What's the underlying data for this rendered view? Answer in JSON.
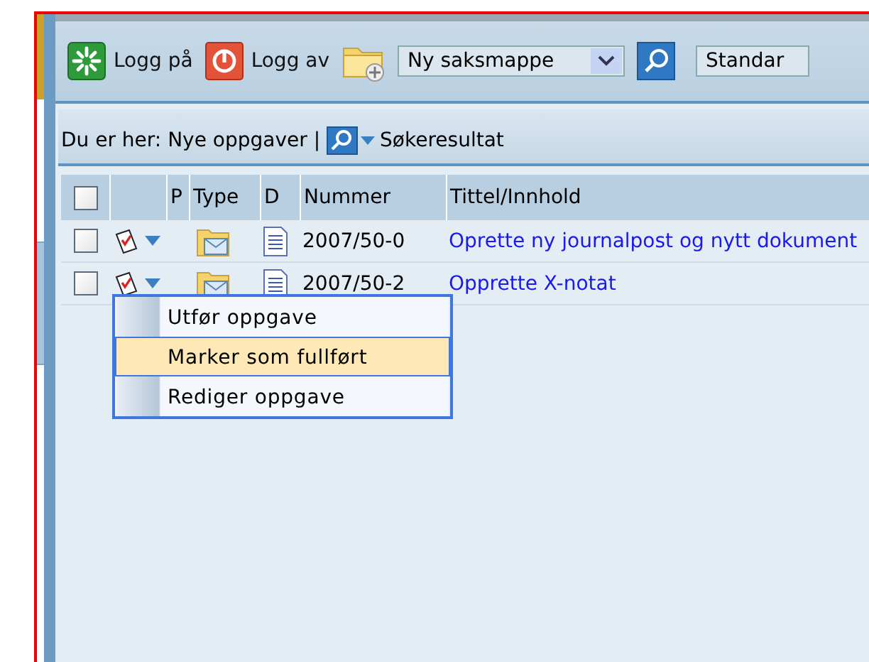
{
  "toolbar": {
    "items": [
      {
        "kind": "login",
        "label": "Logg på"
      },
      {
        "kind": "logout",
        "label": "Logg av"
      },
      {
        "kind": "new-folder"
      },
      {
        "kind": "select",
        "value": "Ny saksmappe"
      },
      {
        "kind": "search"
      },
      {
        "kind": "select",
        "value": "Standar"
      }
    ]
  },
  "breadcrumb": {
    "label": "Du er her: Nye oppgaver |",
    "current": "Søkeresultat"
  },
  "table": {
    "select_all": {
      "checked": false
    },
    "columns": [
      "P",
      "Type",
      "D",
      "Nummer",
      "Tittel/Innhold"
    ],
    "rows": [
      {
        "checked": false,
        "number": "2007/50-0",
        "title": "Oprette ny journalpost og nytt dokument"
      },
      {
        "checked": false,
        "number": "2007/50-2",
        "title": "Opprette X-notat"
      }
    ]
  },
  "context_menu": {
    "items": [
      {
        "label": "Utfør oppgave",
        "selected": false
      },
      {
        "label": "Marker som fullført",
        "selected": true
      },
      {
        "label": "Rediger oppgave",
        "selected": false
      }
    ]
  }
}
